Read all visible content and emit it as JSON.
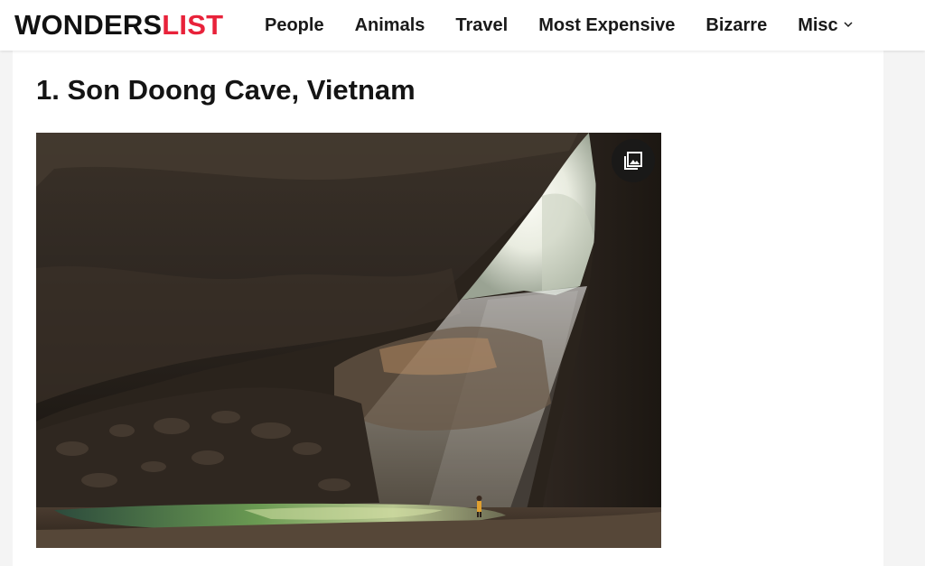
{
  "site": {
    "logo_part1": "WONDERS",
    "logo_part2": "LIST",
    "brand_color": "#e8223a"
  },
  "nav": {
    "items": [
      {
        "label": "People"
      },
      {
        "label": "Animals"
      },
      {
        "label": "Travel"
      },
      {
        "label": "Most Expensive"
      },
      {
        "label": "Bizarre"
      },
      {
        "label": "Misc",
        "icon": "chevron-down-icon"
      }
    ]
  },
  "article": {
    "heading": "1. Son Doong Cave, Vietnam",
    "image": {
      "subject": "cave-photo",
      "gallery_icon": "gallery-icon"
    }
  }
}
